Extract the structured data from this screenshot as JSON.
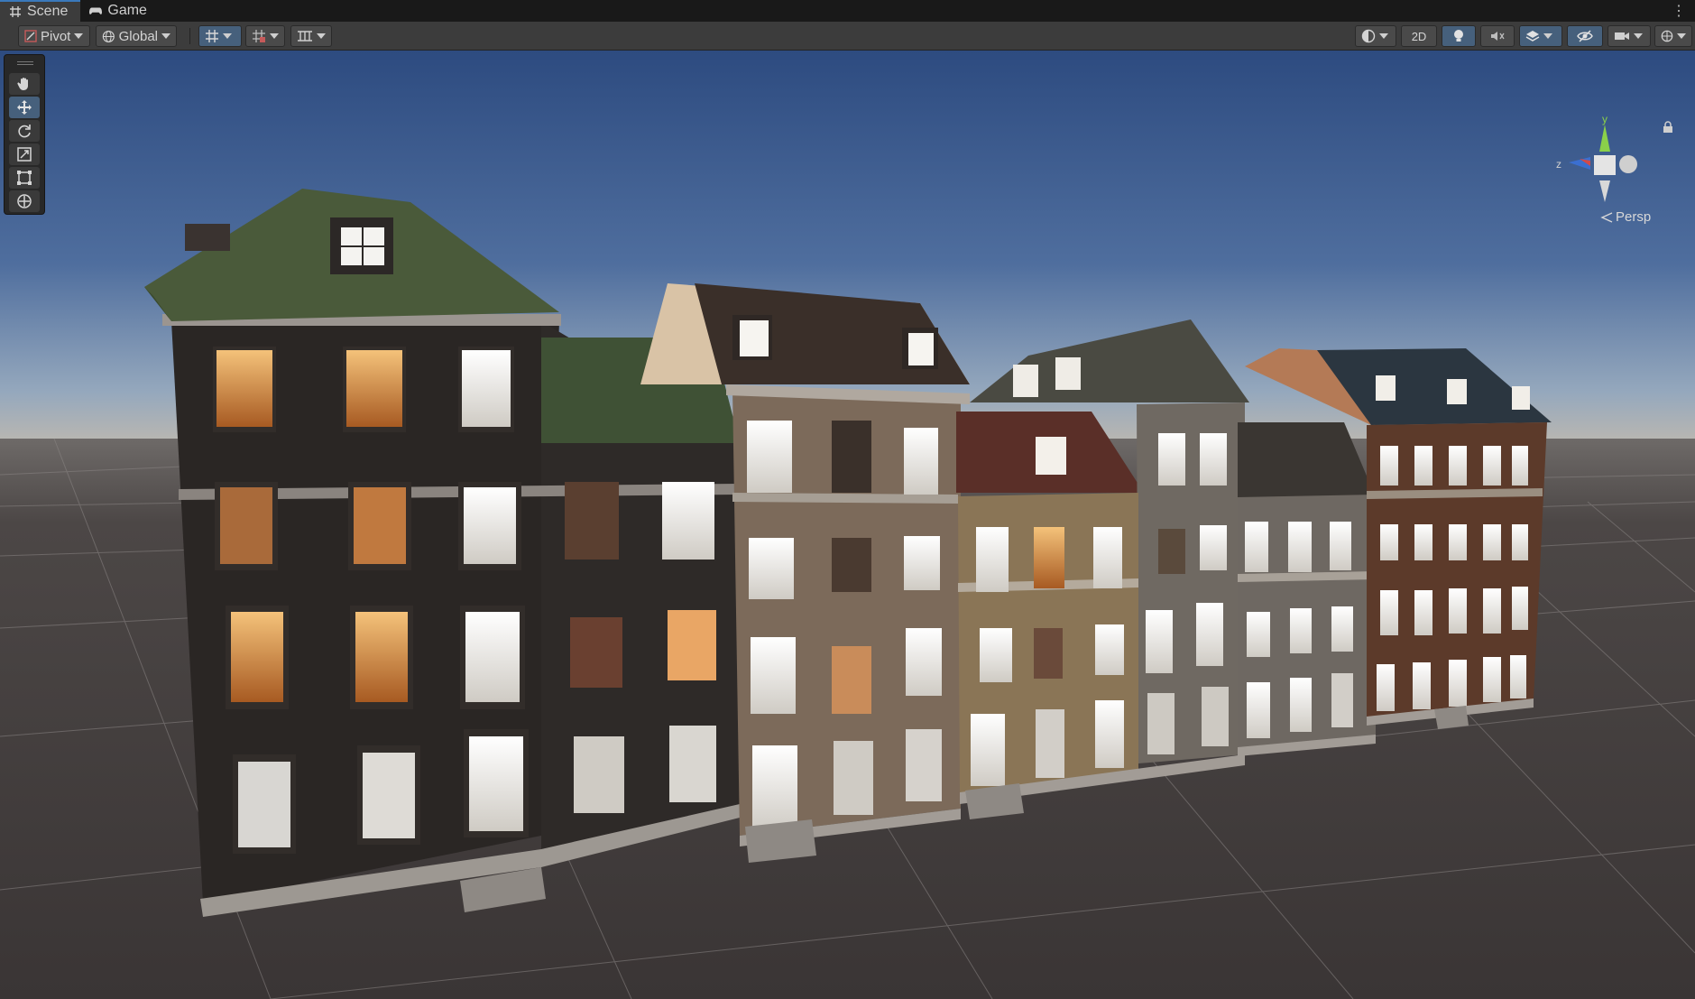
{
  "tabs": [
    {
      "label": "Scene",
      "icon": "grid-icon",
      "active": true
    },
    {
      "label": "Game",
      "icon": "gamepad-icon",
      "active": false
    }
  ],
  "toolbar": {
    "pivot_label": "Pivot",
    "global_label": "Global",
    "twod_label": "2D"
  },
  "tools": [
    "hand-tool",
    "move-tool",
    "rotate-tool",
    "scale-tool",
    "rect-tool",
    "transform-tool"
  ],
  "gizmo": {
    "y_label": "y",
    "z_label": "z",
    "projection_label": "Persp"
  },
  "colors": {
    "accent": "#3a79bb",
    "toggle_on": "#46607c",
    "sky_top": "#2f4e84",
    "sky_horizon": "#8fa6bf",
    "ground": "#3c3838"
  }
}
